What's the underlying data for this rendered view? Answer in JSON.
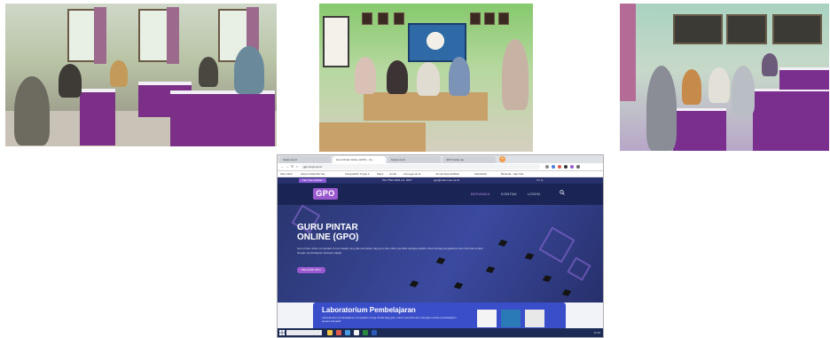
{
  "browser": {
    "tabs": [
      {
        "label": "Kelas.net.id"
      },
      {
        "label": "Guru Pintar Online (GPO) - Un..."
      },
      {
        "label": "Kelas.net.id"
      },
      {
        "label": "GPO Kelas.net"
      }
    ],
    "url": "gpo.umpo.ac.id",
    "bookmarks": [
      {
        "label": "Situs Web"
      },
      {
        "label": "Akses Kuliah Ba Sej..."
      },
      {
        "label": "Kangotakhir Tugas 2"
      },
      {
        "label": "Maps"
      },
      {
        "label": "Gmail"
      },
      {
        "label": "www.gpo.ac.id"
      },
      {
        "label": "Jurnal Kependidikan"
      },
      {
        "label": "Sekolahan"
      },
      {
        "label": "Beranda - Ajar Kita"
      }
    ]
  },
  "site": {
    "topbar": {
      "cta": "Fitur Kemudahan",
      "phone": "021-7591-9964 ext. 2027",
      "email": "gpo@mail.umpo.ac.id",
      "social": "f  in  ◎"
    },
    "logo": "GPO",
    "menu": [
      "BERANDA",
      "KONTAK",
      "LOGIN"
    ],
    "hero": {
      "title": "GURU PINTAR ONLINE (GPO)",
      "description": "Guru pintar online merupakan forum belajar yang diperuntukkan bagi guru dan calon pendidik sebagai wadah untuk berbagi pengalaman dan informasi terkait dengan pembelajaran berbasis digital.",
      "button": "PELAJARI GPO"
    },
    "lab": {
      "title": "Laboratorium Pembelajaran",
      "description": "Laboratorium pembelajaran merupakan ruang virtual bagi guru untuk mencoba dan menguji metode pembelajaran secara interaktif."
    }
  },
  "taskbar": {
    "clock": "11:15"
  },
  "colors": {
    "accent": "#9b59d0",
    "header": "#1b2555",
    "hero": "#2a3670",
    "lab_card": "#3a4ec9",
    "taskbar": "#1c2b55"
  }
}
